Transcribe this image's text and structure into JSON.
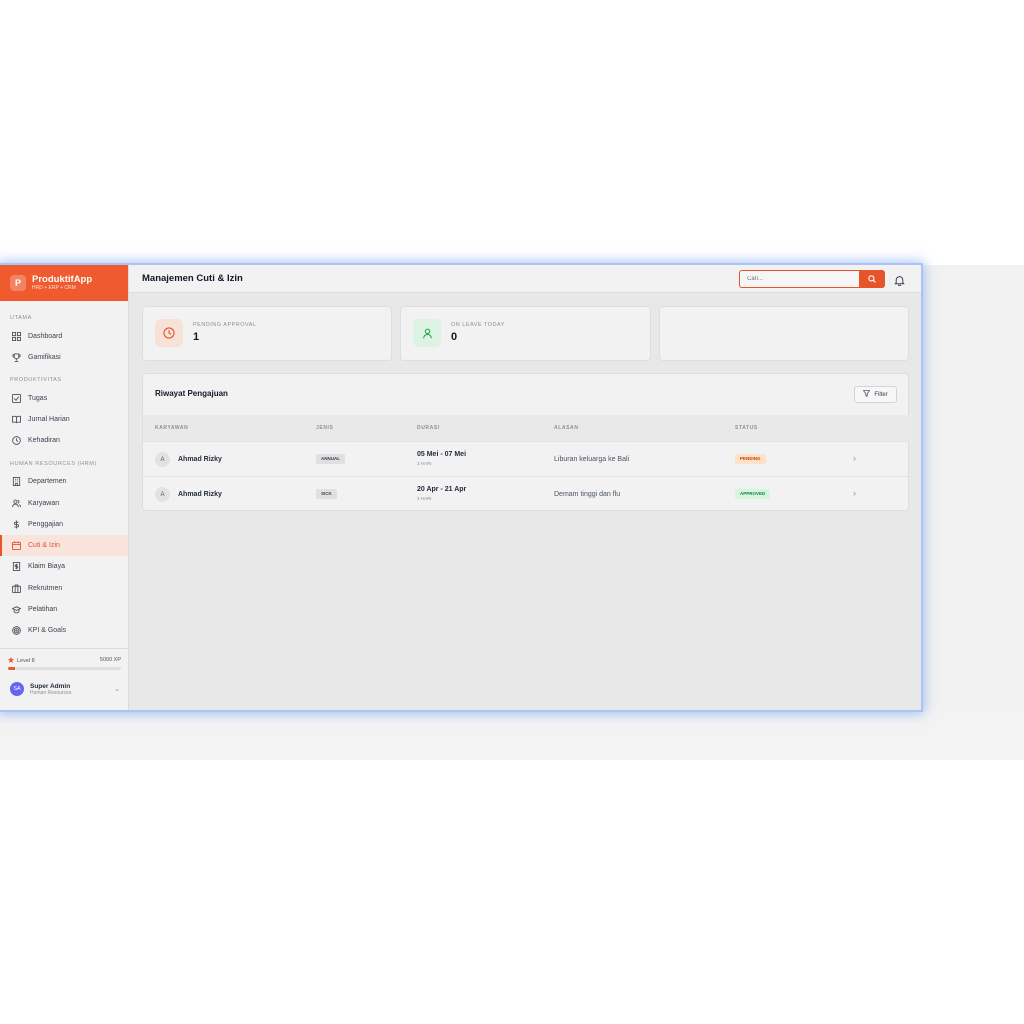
{
  "brand": {
    "logo_letter": "P",
    "name": "ProduktifApp",
    "subtitle": "HRD + ERP + CRM"
  },
  "sidebar": {
    "sections": [
      {
        "label": "UTAMA"
      },
      {
        "label": "PRODUKTIVITAS"
      },
      {
        "label": "HUMAN RESOURCES (HRM)"
      }
    ],
    "items": [
      {
        "label": "Dashboard",
        "icon": "grid-icon"
      },
      {
        "label": "Gamifikasi",
        "icon": "trophy-icon"
      },
      {
        "label": "Tugas",
        "icon": "checkbox-icon"
      },
      {
        "label": "Jurnal Harian",
        "icon": "book-icon"
      },
      {
        "label": "Kehadiran",
        "icon": "clock-icon"
      },
      {
        "label": "Departemen",
        "icon": "building-icon"
      },
      {
        "label": "Karyawan",
        "icon": "users-icon"
      },
      {
        "label": "Penggajian",
        "icon": "dollar-icon"
      },
      {
        "label": "Cuti & Izin",
        "icon": "calendar-icon",
        "active": true
      },
      {
        "label": "Klaim Biaya",
        "icon": "receipt-icon"
      },
      {
        "label": "Rekrutmen",
        "icon": "briefcase-icon"
      },
      {
        "label": "Pelatihan",
        "icon": "graduation-cap-icon"
      },
      {
        "label": "KPI & Goals",
        "icon": "target-icon"
      }
    ],
    "footer": {
      "level": "Level 8",
      "xp": "5000 XP",
      "xp_progress": 0.06,
      "user_initials": "SA",
      "user_name": "Super Admin",
      "user_role": "Human Resources"
    }
  },
  "header": {
    "title": "Manajemen Cuti & Izin",
    "search_placeholder": "Cari..."
  },
  "stats": [
    {
      "label": "PENDING APPROVAL",
      "value": "1",
      "icon": "clock-icon",
      "color": "#e5542a"
    },
    {
      "label": "ON LEAVE TODAY",
      "value": "0",
      "icon": "user-icon",
      "color": "#16a34a"
    }
  ],
  "history": {
    "title": "Riwayat Pengajuan",
    "filter_label": "Filter",
    "columns": [
      "KARYAWAN",
      "JENIS",
      "DURASI",
      "ALASAN",
      "STATUS"
    ],
    "rows": [
      {
        "initial": "A",
        "name": "Ahmad Rizky",
        "type": "ANNUAL",
        "duration": "05 Mei - 07 Mei",
        "days": "3 HARI",
        "reason": "Liburan keluarga ke Bali",
        "status": "PENDING"
      },
      {
        "initial": "A",
        "name": "Ahmad Rizky",
        "type": "SICK",
        "duration": "20 Apr - 21 Apr",
        "days": "2 HARI",
        "reason": "Demam tinggi dan flu",
        "status": "APPROVED"
      }
    ]
  },
  "colors": {
    "accent": "#ef5a2e",
    "pending_bg": "#fde2c8",
    "pending_text": "#c2410c",
    "approved_bg": "#d5f5dd",
    "approved_text": "#15803d"
  }
}
